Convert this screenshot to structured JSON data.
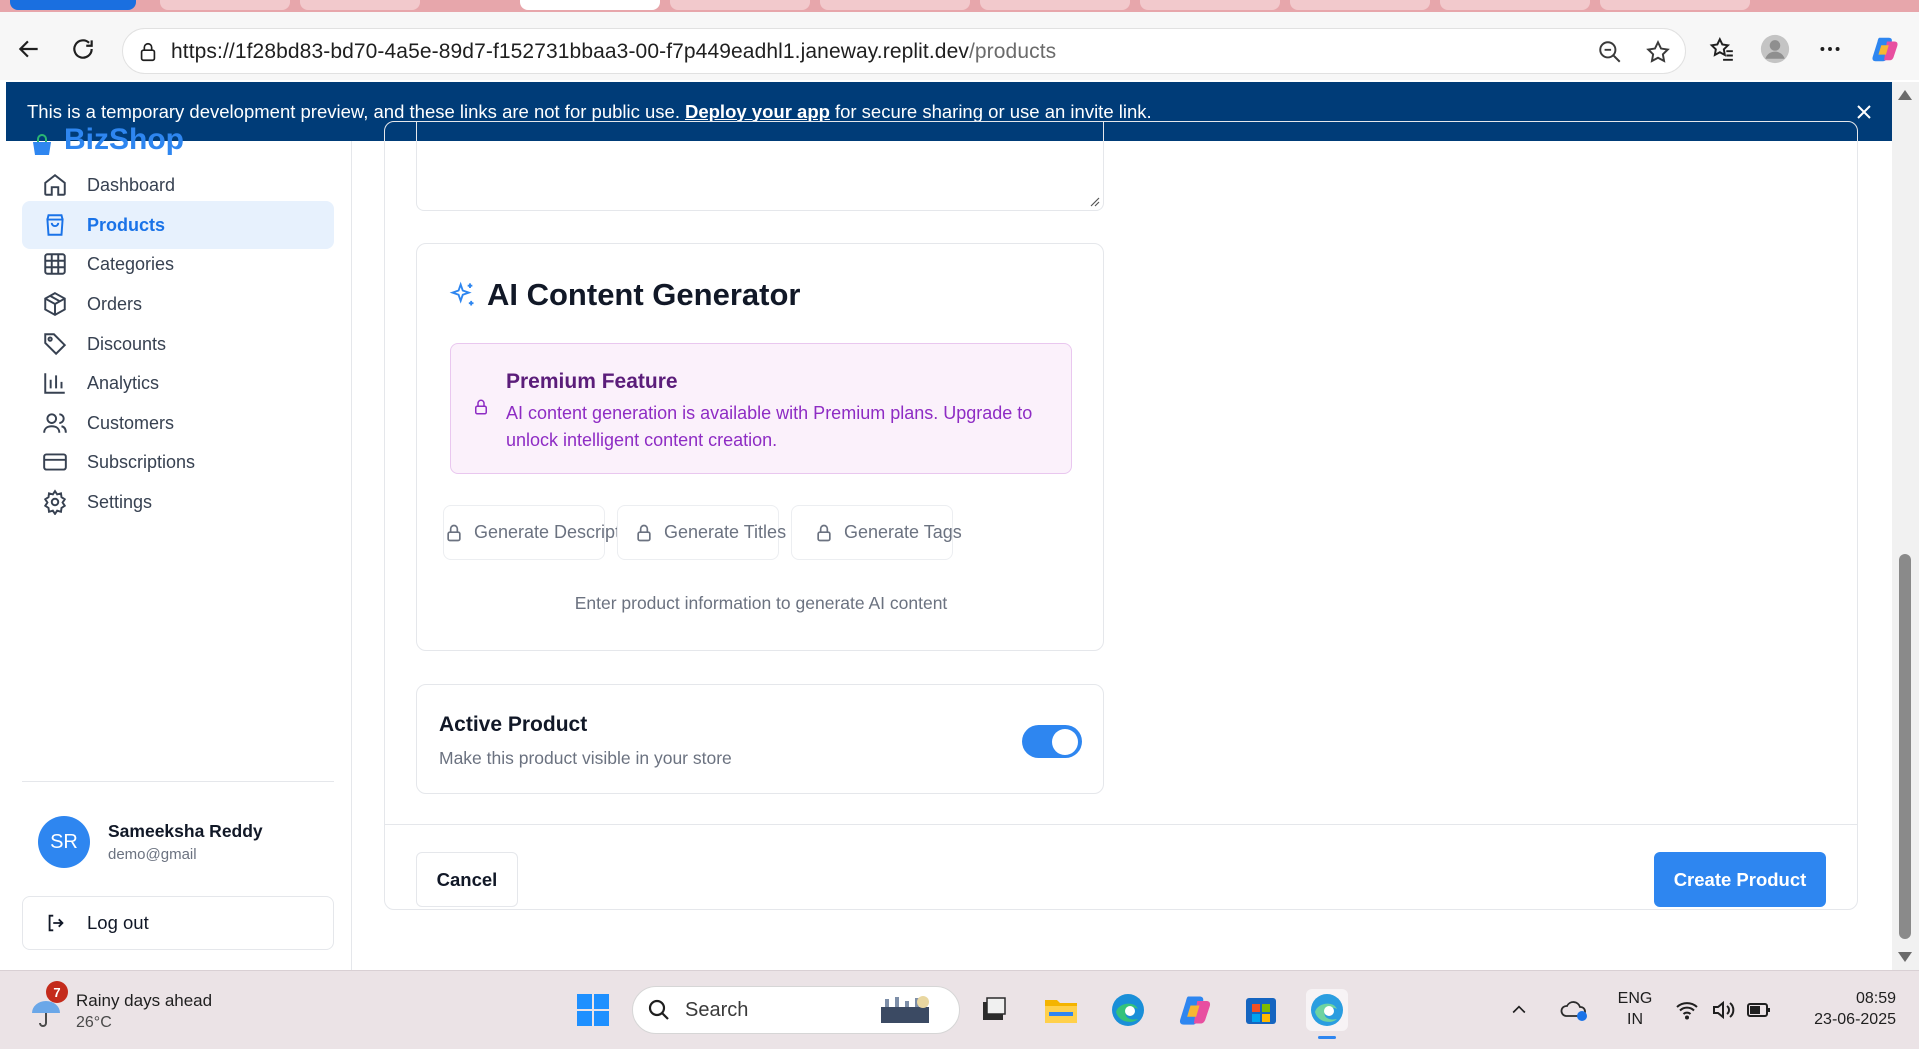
{
  "browser": {
    "url_main": "https://1f28bd83-bd70-4a5e-89d7-f152731bbaa3-00-f7p449eadhl1.janeway.replit.dev",
    "url_path": "/products"
  },
  "banner": {
    "text_before": "This is a temporary development preview, and these links are not for public use.",
    "link_text": "Deploy your app",
    "text_after": "for secure sharing or use an invite link."
  },
  "sidebar": {
    "brand": "BizShop",
    "items": [
      {
        "label": "Dashboard",
        "icon": "home-icon"
      },
      {
        "label": "Products",
        "icon": "shopping-bag-icon",
        "active": true
      },
      {
        "label": "Categories",
        "icon": "grid-icon"
      },
      {
        "label": "Orders",
        "icon": "package-icon"
      },
      {
        "label": "Discounts",
        "icon": "tag-icon"
      },
      {
        "label": "Analytics",
        "icon": "bar-chart-icon"
      },
      {
        "label": "Customers",
        "icon": "users-icon"
      },
      {
        "label": "Subscriptions",
        "icon": "credit-card-icon"
      },
      {
        "label": "Settings",
        "icon": "gear-icon"
      }
    ],
    "user": {
      "initials": "SR",
      "name": "Sameeksha Reddy",
      "email": "demo@gmail"
    },
    "logout_label": "Log out"
  },
  "ai_generator": {
    "title": "AI Content Generator",
    "premium_title": "Premium Feature",
    "premium_text": "AI content generation is available with Premium plans. Upgrade to unlock intelligent content creation.",
    "buttons": [
      "Generate Description",
      "Generate Titles",
      "Generate Tags"
    ],
    "hint": "Enter product information to generate AI content"
  },
  "active_product": {
    "title": "Active Product",
    "description": "Make this product visible in your store",
    "enabled": true
  },
  "actions": {
    "cancel": "Cancel",
    "create": "Create Product"
  },
  "taskbar": {
    "weather_badge": "7",
    "weather_title": "Rainy days ahead",
    "weather_temp": "26°C",
    "search_label": "Search",
    "lang_line1": "ENG",
    "lang_line2": "IN",
    "time": "08:59",
    "date": "23-06-2025"
  },
  "colors": {
    "accent": "#2e86f0",
    "banner_bg": "#003c78",
    "premium_bg": "#fbf1fb",
    "premium_text": "#8e2cc4"
  }
}
